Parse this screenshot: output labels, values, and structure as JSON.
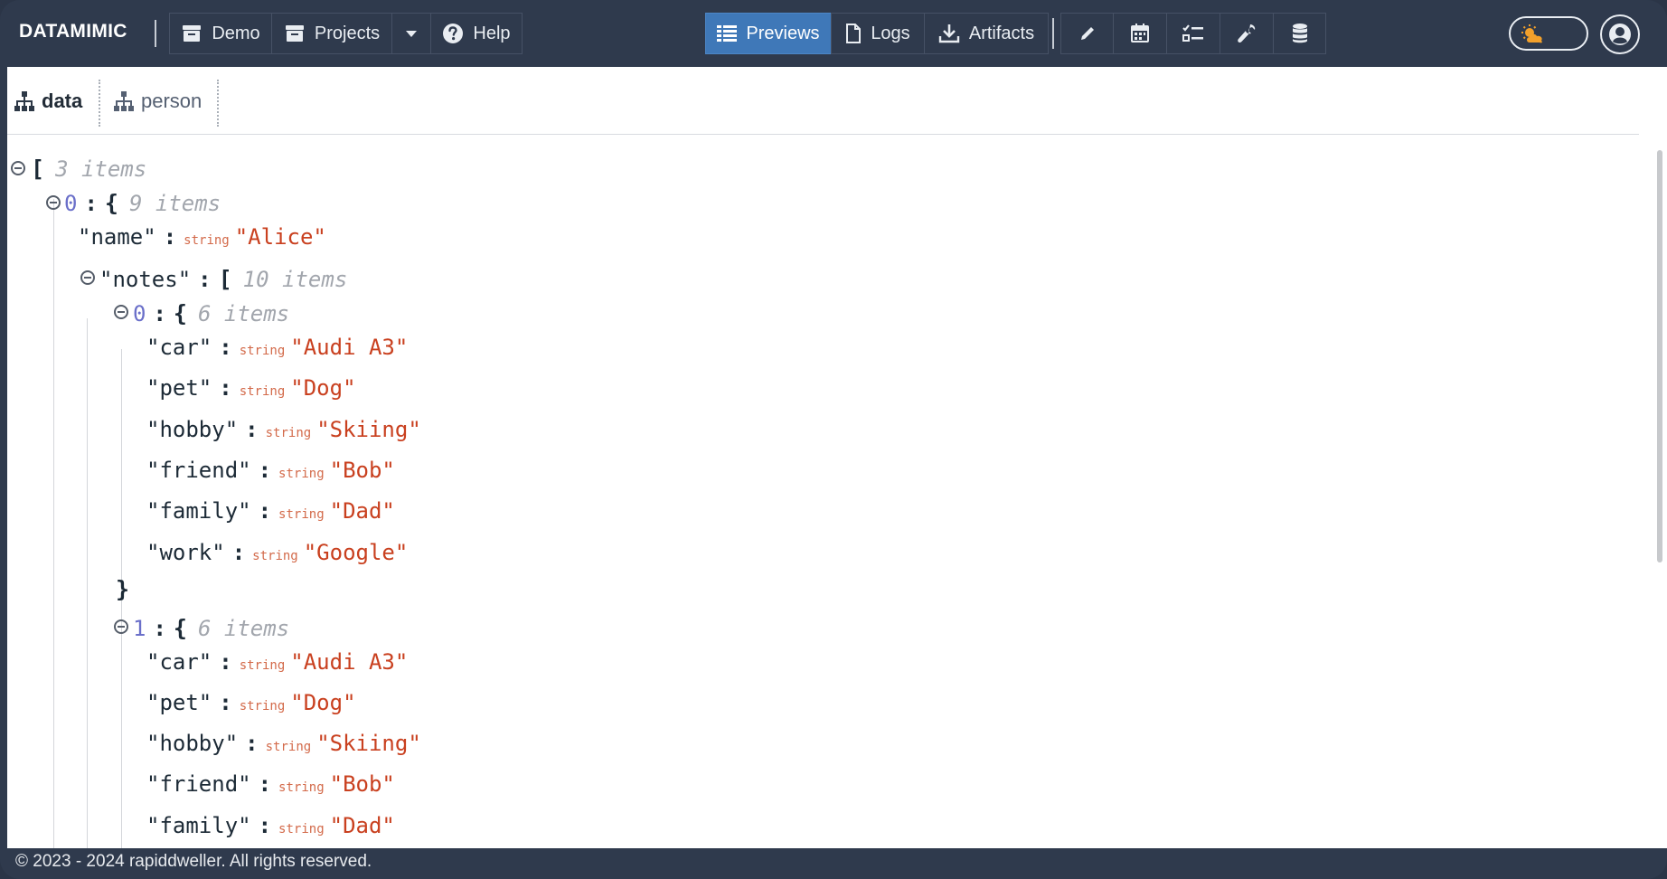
{
  "app": {
    "brand": "DATAMIMIC"
  },
  "nav": {
    "demo": "Demo",
    "projects": "Projects",
    "help": "Help",
    "previews": "Previews",
    "logs": "Logs",
    "artifacts": "Artifacts"
  },
  "tabs": [
    {
      "label": "data",
      "active": true
    },
    {
      "label": "person",
      "active": false
    }
  ],
  "tree": {
    "root_count": "3 items",
    "item0": {
      "index": "0",
      "count": "9 items",
      "name_key": "\"name\"",
      "name_type": "string",
      "name_value": "\"Alice\"",
      "notes_key": "\"notes\"",
      "notes_count": "10 items"
    },
    "notes": [
      {
        "index": "0",
        "count": "6 items",
        "fields": [
          {
            "key": "\"car\"",
            "type": "string",
            "value": "\"Audi A3\""
          },
          {
            "key": "\"pet\"",
            "type": "string",
            "value": "\"Dog\""
          },
          {
            "key": "\"hobby\"",
            "type": "string",
            "value": "\"Skiing\""
          },
          {
            "key": "\"friend\"",
            "type": "string",
            "value": "\"Bob\""
          },
          {
            "key": "\"family\"",
            "type": "string",
            "value": "\"Dad\""
          },
          {
            "key": "\"work\"",
            "type": "string",
            "value": "\"Google\""
          }
        ]
      },
      {
        "index": "1",
        "count": "6 items",
        "fields": [
          {
            "key": "\"car\"",
            "type": "string",
            "value": "\"Audi A3\""
          },
          {
            "key": "\"pet\"",
            "type": "string",
            "value": "\"Dog\""
          },
          {
            "key": "\"hobby\"",
            "type": "string",
            "value": "\"Skiing\""
          },
          {
            "key": "\"friend\"",
            "type": "string",
            "value": "\"Bob\""
          },
          {
            "key": "\"family\"",
            "type": "string",
            "value": "\"Dad\""
          }
        ]
      }
    ]
  },
  "footer": {
    "copyright": "© 2023 - 2024 rapiddweller. All rights reserved."
  }
}
